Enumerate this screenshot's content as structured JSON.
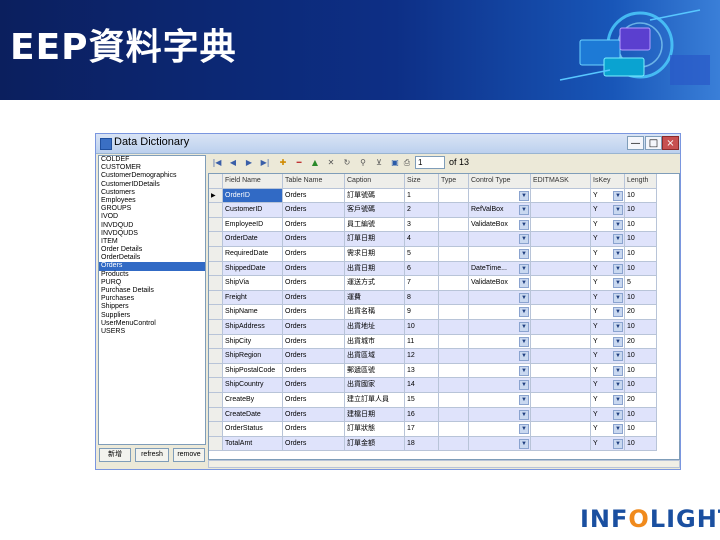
{
  "banner": {
    "title": "EEP資料字典"
  },
  "window": {
    "title": "Data Dictionary",
    "minimize": "—",
    "maximize": "□",
    "close": "×"
  },
  "tables_list": [
    "COLDEF",
    "CUSTOMER",
    "CustomerDemographics",
    "CustomerIDDetails",
    "Customers",
    "Employees",
    "GROUPS",
    "IVOD",
    "INVDQUD",
    "INVDQUDS",
    "ITEM",
    "Order Details",
    "OrderDetails",
    "Orders",
    "Products",
    "PURQ",
    "Purchase Details",
    "Purchases",
    "Shippers",
    "Suppliers",
    "UserMenuControl",
    "USERS"
  ],
  "selected_table": "Orders",
  "list_buttons": {
    "add": "新增",
    "refresh": "refresh",
    "remove": "remove"
  },
  "navigator": {
    "position": "1",
    "of": "of 13"
  },
  "grid": {
    "headers": [
      "Field Name",
      "Table Name",
      "Caption",
      "Size",
      "Type",
      "Control Type",
      "EDITMASK",
      "IsKey",
      "Length"
    ],
    "rows": [
      [
        "OrderID",
        "Orders",
        "訂單號碼",
        "1",
        "",
        "",
        "",
        "Y",
        "10"
      ],
      [
        "CustomerID",
        "Orders",
        "客戶號碼",
        "2",
        "",
        "RefValBox",
        "",
        "Y",
        "10"
      ],
      [
        "EmployeeID",
        "Orders",
        "員工編號",
        "3",
        "",
        "ValidateBox",
        "",
        "Y",
        "10"
      ],
      [
        "OrderDate",
        "Orders",
        "訂單日期",
        "4",
        "",
        "",
        "",
        "Y",
        "10"
      ],
      [
        "RequiredDate",
        "Orders",
        "需求日期",
        "5",
        "",
        "",
        "",
        "Y",
        "10"
      ],
      [
        "ShippedDate",
        "Orders",
        "出貨日期",
        "6",
        "",
        "DateTime...",
        "",
        "Y",
        "10"
      ],
      [
        "ShipVia",
        "Orders",
        "運送方式",
        "7",
        "",
        "ValidateBox",
        "",
        "Y",
        "5"
      ],
      [
        "Freight",
        "Orders",
        "運費",
        "8",
        "",
        "",
        "",
        "Y",
        "10"
      ],
      [
        "ShipName",
        "Orders",
        "出貨名稱",
        "9",
        "",
        "",
        "",
        "Y",
        "20"
      ],
      [
        "ShipAddress",
        "Orders",
        "出貨地址",
        "10",
        "",
        "",
        "",
        "Y",
        "10"
      ],
      [
        "ShipCity",
        "Orders",
        "出貨城市",
        "11",
        "",
        "",
        "",
        "Y",
        "20"
      ],
      [
        "ShipRegion",
        "Orders",
        "出貨區域",
        "12",
        "",
        "",
        "",
        "Y",
        "10"
      ],
      [
        "ShipPostalCode",
        "Orders",
        "郵遞區號",
        "13",
        "",
        "",
        "",
        "Y",
        "10"
      ],
      [
        "ShipCountry",
        "Orders",
        "出貨國家",
        "14",
        "",
        "",
        "",
        "Y",
        "10"
      ],
      [
        "CreateBy",
        "Orders",
        "建立訂單人員",
        "15",
        "",
        "",
        "",
        "Y",
        "20"
      ],
      [
        "CreateDate",
        "Orders",
        "建檔日期",
        "16",
        "",
        "",
        "",
        "Y",
        "10"
      ],
      [
        "OrderStatus",
        "Orders",
        "訂單狀態",
        "17",
        "",
        "",
        "",
        "Y",
        "10"
      ],
      [
        "TotalAmt",
        "Orders",
        "訂單金額",
        "18",
        "",
        "",
        "",
        "Y",
        "10"
      ]
    ]
  },
  "logo": {
    "part1": "INF",
    "part2": "O",
    "part3": "LIGHT"
  },
  "colors": {
    "banner": "#0d2f86",
    "selected_row": "#316ac5",
    "alt_row": "#dfe3fb",
    "logo_blue": "#1a4fa0",
    "logo_orange": "#f08a1c"
  }
}
